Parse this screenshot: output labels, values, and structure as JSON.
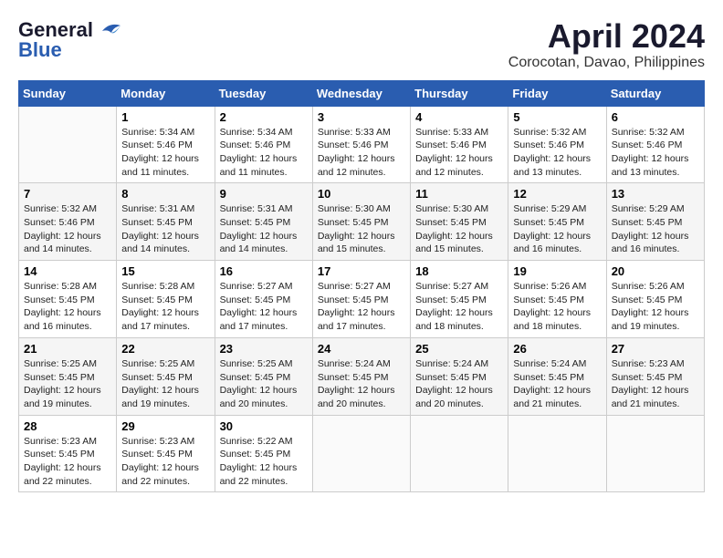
{
  "logo": {
    "line1": "General",
    "line2": "Blue"
  },
  "title": "April 2024",
  "subtitle": "Corocotan, Davao, Philippines",
  "headers": [
    "Sunday",
    "Monday",
    "Tuesday",
    "Wednesday",
    "Thursday",
    "Friday",
    "Saturday"
  ],
  "weeks": [
    [
      {
        "day": "",
        "info": ""
      },
      {
        "day": "1",
        "info": "Sunrise: 5:34 AM\nSunset: 5:46 PM\nDaylight: 12 hours\nand 11 minutes."
      },
      {
        "day": "2",
        "info": "Sunrise: 5:34 AM\nSunset: 5:46 PM\nDaylight: 12 hours\nand 11 minutes."
      },
      {
        "day": "3",
        "info": "Sunrise: 5:33 AM\nSunset: 5:46 PM\nDaylight: 12 hours\nand 12 minutes."
      },
      {
        "day": "4",
        "info": "Sunrise: 5:33 AM\nSunset: 5:46 PM\nDaylight: 12 hours\nand 12 minutes."
      },
      {
        "day": "5",
        "info": "Sunrise: 5:32 AM\nSunset: 5:46 PM\nDaylight: 12 hours\nand 13 minutes."
      },
      {
        "day": "6",
        "info": "Sunrise: 5:32 AM\nSunset: 5:46 PM\nDaylight: 12 hours\nand 13 minutes."
      }
    ],
    [
      {
        "day": "7",
        "info": "Sunrise: 5:32 AM\nSunset: 5:46 PM\nDaylight: 12 hours\nand 14 minutes."
      },
      {
        "day": "8",
        "info": "Sunrise: 5:31 AM\nSunset: 5:45 PM\nDaylight: 12 hours\nand 14 minutes."
      },
      {
        "day": "9",
        "info": "Sunrise: 5:31 AM\nSunset: 5:45 PM\nDaylight: 12 hours\nand 14 minutes."
      },
      {
        "day": "10",
        "info": "Sunrise: 5:30 AM\nSunset: 5:45 PM\nDaylight: 12 hours\nand 15 minutes."
      },
      {
        "day": "11",
        "info": "Sunrise: 5:30 AM\nSunset: 5:45 PM\nDaylight: 12 hours\nand 15 minutes."
      },
      {
        "day": "12",
        "info": "Sunrise: 5:29 AM\nSunset: 5:45 PM\nDaylight: 12 hours\nand 16 minutes."
      },
      {
        "day": "13",
        "info": "Sunrise: 5:29 AM\nSunset: 5:45 PM\nDaylight: 12 hours\nand 16 minutes."
      }
    ],
    [
      {
        "day": "14",
        "info": "Sunrise: 5:28 AM\nSunset: 5:45 PM\nDaylight: 12 hours\nand 16 minutes."
      },
      {
        "day": "15",
        "info": "Sunrise: 5:28 AM\nSunset: 5:45 PM\nDaylight: 12 hours\nand 17 minutes."
      },
      {
        "day": "16",
        "info": "Sunrise: 5:27 AM\nSunset: 5:45 PM\nDaylight: 12 hours\nand 17 minutes."
      },
      {
        "day": "17",
        "info": "Sunrise: 5:27 AM\nSunset: 5:45 PM\nDaylight: 12 hours\nand 17 minutes."
      },
      {
        "day": "18",
        "info": "Sunrise: 5:27 AM\nSunset: 5:45 PM\nDaylight: 12 hours\nand 18 minutes."
      },
      {
        "day": "19",
        "info": "Sunrise: 5:26 AM\nSunset: 5:45 PM\nDaylight: 12 hours\nand 18 minutes."
      },
      {
        "day": "20",
        "info": "Sunrise: 5:26 AM\nSunset: 5:45 PM\nDaylight: 12 hours\nand 19 minutes."
      }
    ],
    [
      {
        "day": "21",
        "info": "Sunrise: 5:25 AM\nSunset: 5:45 PM\nDaylight: 12 hours\nand 19 minutes."
      },
      {
        "day": "22",
        "info": "Sunrise: 5:25 AM\nSunset: 5:45 PM\nDaylight: 12 hours\nand 19 minutes."
      },
      {
        "day": "23",
        "info": "Sunrise: 5:25 AM\nSunset: 5:45 PM\nDaylight: 12 hours\nand 20 minutes."
      },
      {
        "day": "24",
        "info": "Sunrise: 5:24 AM\nSunset: 5:45 PM\nDaylight: 12 hours\nand 20 minutes."
      },
      {
        "day": "25",
        "info": "Sunrise: 5:24 AM\nSunset: 5:45 PM\nDaylight: 12 hours\nand 20 minutes."
      },
      {
        "day": "26",
        "info": "Sunrise: 5:24 AM\nSunset: 5:45 PM\nDaylight: 12 hours\nand 21 minutes."
      },
      {
        "day": "27",
        "info": "Sunrise: 5:23 AM\nSunset: 5:45 PM\nDaylight: 12 hours\nand 21 minutes."
      }
    ],
    [
      {
        "day": "28",
        "info": "Sunrise: 5:23 AM\nSunset: 5:45 PM\nDaylight: 12 hours\nand 22 minutes."
      },
      {
        "day": "29",
        "info": "Sunrise: 5:23 AM\nSunset: 5:45 PM\nDaylight: 12 hours\nand 22 minutes."
      },
      {
        "day": "30",
        "info": "Sunrise: 5:22 AM\nSunset: 5:45 PM\nDaylight: 12 hours\nand 22 minutes."
      },
      {
        "day": "",
        "info": ""
      },
      {
        "day": "",
        "info": ""
      },
      {
        "day": "",
        "info": ""
      },
      {
        "day": "",
        "info": ""
      }
    ]
  ]
}
